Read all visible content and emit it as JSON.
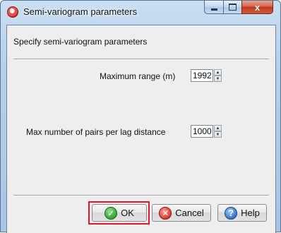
{
  "window": {
    "title": "Semi-variogram parameters",
    "close_glyph": "x"
  },
  "dialog": {
    "heading": "Specify semi-variogram parameters",
    "max_range": {
      "label": "Maximum range (m)",
      "value": "1992"
    },
    "max_pairs": {
      "label": "Max number of pairs per lag distance",
      "value": "1000"
    }
  },
  "buttons": {
    "ok": "OK",
    "cancel": "Cancel",
    "help": "Help"
  },
  "icons": {
    "app": "app-icon",
    "ok": "check-icon",
    "cancel": "x-icon",
    "help": "question-icon"
  },
  "colors": {
    "highlight": "#e8162b",
    "close_button": "#c0391c"
  }
}
